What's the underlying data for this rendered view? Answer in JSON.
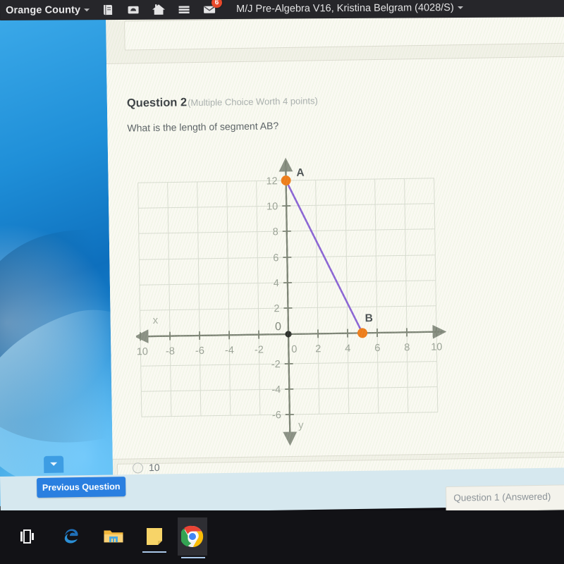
{
  "topbar": {
    "district": "Orange County",
    "course": "M/J Pre-Algebra V16, Kristina Belgram (4028/S)",
    "icons": [
      {
        "name": "book-icon",
        "glyph": "book"
      },
      {
        "name": "inbox-icon",
        "glyph": "inbox"
      },
      {
        "name": "home-icon",
        "glyph": "home"
      },
      {
        "name": "menu-icon",
        "glyph": "hamburger"
      },
      {
        "name": "mail-icon",
        "glyph": "envelope",
        "badge": "6"
      }
    ],
    "mail_badge": "6"
  },
  "question": {
    "number_label": "Question 2",
    "meta": "(Multiple Choice Worth 4 points)",
    "prompt": "What is the length of segment AB?",
    "first_option": "10"
  },
  "nav": {
    "previous_button": "Previous Question",
    "question_select_value": "Question 1 (Answered)"
  },
  "taskbar": {
    "items": [
      {
        "name": "task-view-icon",
        "label": "Task View"
      },
      {
        "name": "edge-icon",
        "label": "Microsoft Edge"
      },
      {
        "name": "file-explorer-icon",
        "label": "File Explorer"
      },
      {
        "name": "sticky-notes-icon",
        "label": "Sticky Notes"
      },
      {
        "name": "chrome-icon",
        "label": "Google Chrome"
      }
    ]
  },
  "colors": {
    "point": "#ef7b18",
    "segment": "#8b63d6",
    "accent_blue": "#2a7fe0",
    "badge_red": "#e8492b",
    "nav_bar": "#d6e8ef"
  },
  "chart_data": {
    "type": "scatter",
    "title": "",
    "xlabel": "x",
    "ylabel": "y",
    "xlim": [
      -11.5,
      11.5
    ],
    "ylim": [
      -7.5,
      13.5
    ],
    "xticks": [
      -10,
      -8,
      -6,
      -4,
      -2,
      0,
      2,
      4,
      6,
      8,
      10
    ],
    "yticks": [
      -6,
      -4,
      -2,
      0,
      2,
      4,
      6,
      8,
      10,
      12
    ],
    "xtick_labels": [
      "-10",
      "-8",
      "-6",
      "-4",
      "-2",
      "0",
      "2",
      "4",
      "6",
      "8",
      "10"
    ],
    "ytick_labels": [
      "-6",
      "-4",
      "-2",
      "0",
      "2",
      "4",
      "6",
      "8",
      "10",
      "12"
    ],
    "origin_label": "0",
    "grid": true,
    "legend": "none",
    "points": [
      {
        "label": "A",
        "x": 0,
        "y": 12
      },
      {
        "label": "B",
        "x": 5,
        "y": 0
      }
    ],
    "origin_point": {
      "label": "",
      "x": 0,
      "y": 0
    },
    "segments": [
      {
        "name": "AB",
        "from": "A",
        "to": "B",
        "x1": 0,
        "y1": 12,
        "x2": 5,
        "y2": 0
      }
    ]
  }
}
